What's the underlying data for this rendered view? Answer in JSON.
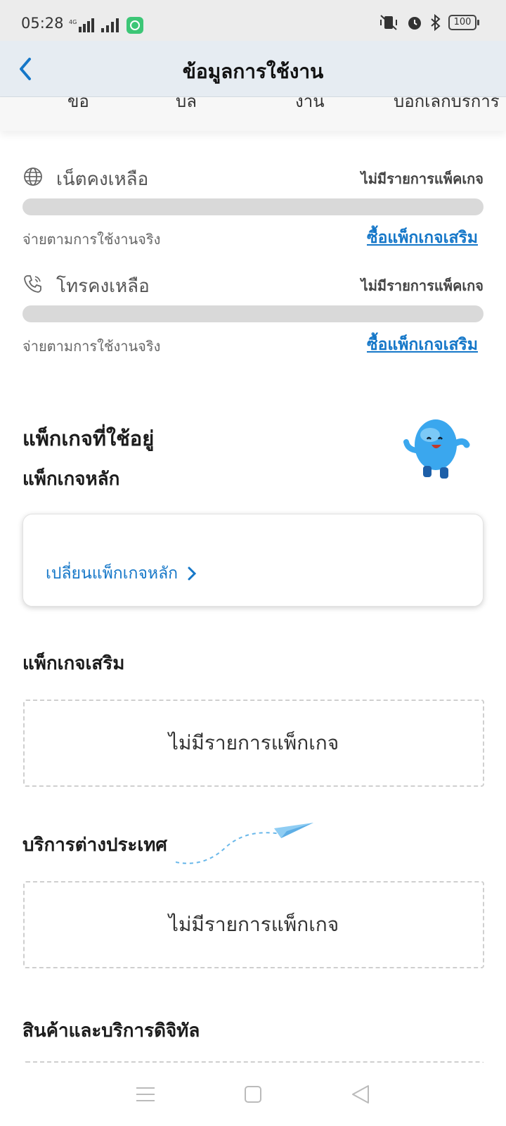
{
  "status_bar": {
    "time": "05:28",
    "network": "4G",
    "battery": "100"
  },
  "header": {
    "title": "ข้อมูลการใช้งาน",
    "back_icon": "chevron-left-icon"
  },
  "balances": [
    {
      "icon": "globe-icon",
      "label": "เน็ตคงเหลือ",
      "status": "ไม่มีรายการแพ็คเกจ",
      "progress_percent": 0,
      "note": "จ่ายตามการใช้งานจริง",
      "link": "ซื้อแพ็กเกจเสริม"
    },
    {
      "icon": "phone-icon",
      "label": "โทรคงเหลือ",
      "status": "ไม่มีรายการแพ็คเกจ",
      "progress_percent": 0,
      "note": "จ่ายตามการใช้งานจริง",
      "link": "ซื้อแพ็กเกจเสริม"
    }
  ],
  "packages": {
    "title": "แพ็กเกจที่ใช้อยู่",
    "main_title": "แพ็กเกจหลัก",
    "change_main": "เปลี่ยนแพ็กเกจหลัก",
    "addon_title": "แพ็กเกจเสริม",
    "addon_empty": "ไม่มีรายการแพ็กเกจ",
    "roaming_title": "บริการต่างประเทศ",
    "roaming_empty": "ไม่มีรายการแพ็กเกจ",
    "digital_title": "สินค้าและบริการดิจิทัล"
  },
  "colors": {
    "accent": "#1577c8",
    "header_bg": "#e6ecf2",
    "track": "#d9d9d9"
  }
}
